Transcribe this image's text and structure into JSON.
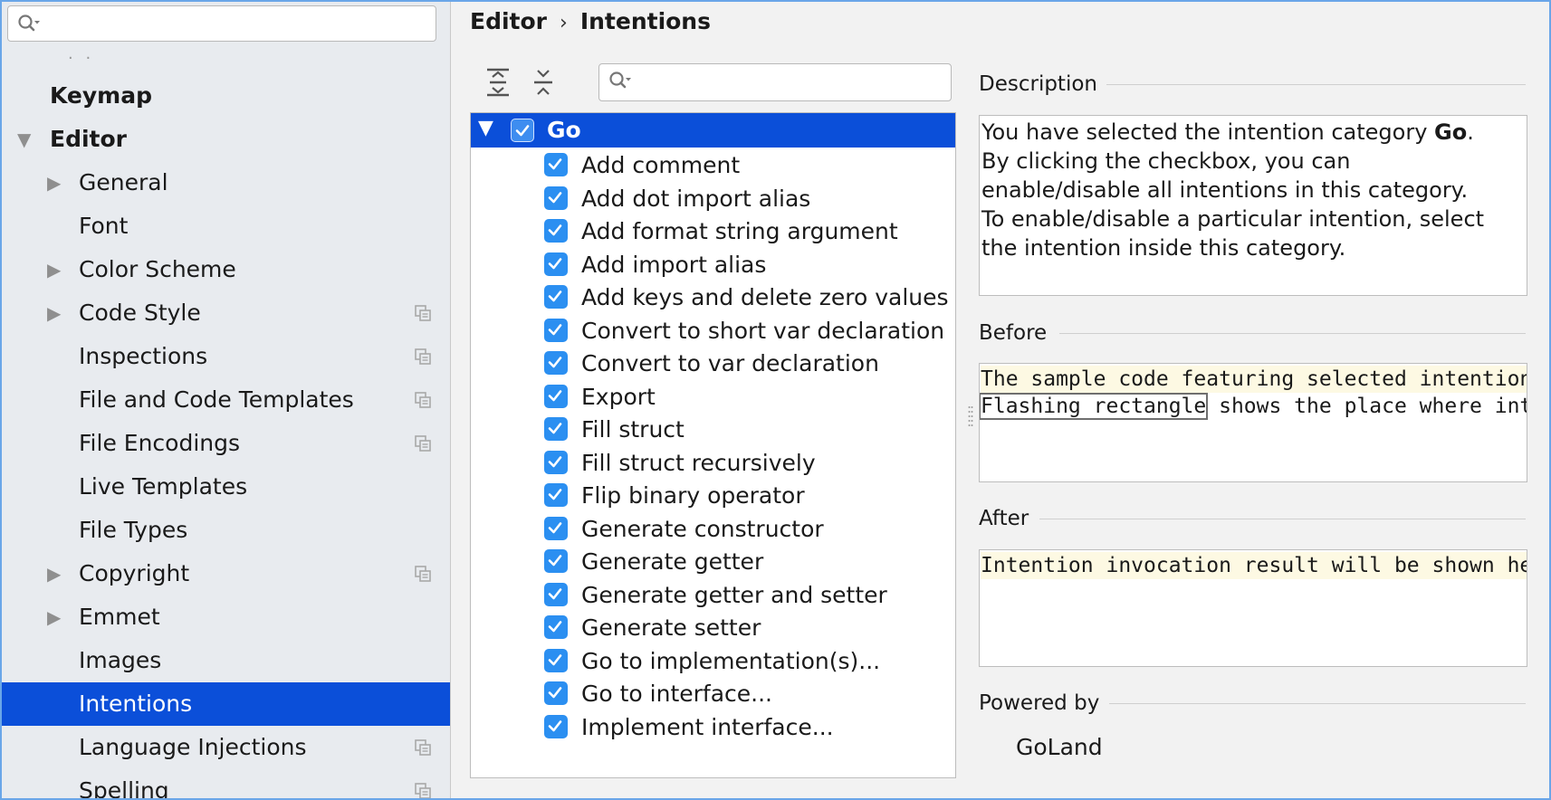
{
  "sidebar": {
    "search_placeholder": "",
    "scroll_hint": "· ·",
    "items": [
      {
        "label": "Keymap",
        "level": 0,
        "bold": true,
        "expander": "none",
        "project": false,
        "selected": false
      },
      {
        "label": "Editor",
        "level": 0,
        "bold": true,
        "expander": "expanded",
        "project": false,
        "selected": false
      },
      {
        "label": "General",
        "level": 1,
        "bold": false,
        "expander": "collapsed",
        "project": false,
        "selected": false
      },
      {
        "label": "Font",
        "level": 1,
        "bold": false,
        "expander": "none",
        "project": false,
        "selected": false
      },
      {
        "label": "Color Scheme",
        "level": 1,
        "bold": false,
        "expander": "collapsed",
        "project": false,
        "selected": false
      },
      {
        "label": "Code Style",
        "level": 1,
        "bold": false,
        "expander": "collapsed",
        "project": true,
        "selected": false
      },
      {
        "label": "Inspections",
        "level": 1,
        "bold": false,
        "expander": "none",
        "project": true,
        "selected": false
      },
      {
        "label": "File and Code Templates",
        "level": 1,
        "bold": false,
        "expander": "none",
        "project": true,
        "selected": false
      },
      {
        "label": "File Encodings",
        "level": 1,
        "bold": false,
        "expander": "none",
        "project": true,
        "selected": false
      },
      {
        "label": "Live Templates",
        "level": 1,
        "bold": false,
        "expander": "none",
        "project": false,
        "selected": false
      },
      {
        "label": "File Types",
        "level": 1,
        "bold": false,
        "expander": "none",
        "project": false,
        "selected": false
      },
      {
        "label": "Copyright",
        "level": 1,
        "bold": false,
        "expander": "collapsed",
        "project": true,
        "selected": false
      },
      {
        "label": "Emmet",
        "level": 1,
        "bold": false,
        "expander": "collapsed",
        "project": false,
        "selected": false
      },
      {
        "label": "Images",
        "level": 1,
        "bold": false,
        "expander": "none",
        "project": false,
        "selected": false
      },
      {
        "label": "Intentions",
        "level": 1,
        "bold": false,
        "expander": "none",
        "project": false,
        "selected": true
      },
      {
        "label": "Language Injections",
        "level": 1,
        "bold": false,
        "expander": "none",
        "project": true,
        "selected": false
      },
      {
        "label": "Spelling",
        "level": 1,
        "bold": false,
        "expander": "none",
        "project": true,
        "selected": false
      }
    ]
  },
  "breadcrumb": {
    "parent": "Editor",
    "separator": "›",
    "current": "Intentions"
  },
  "toolbar": {
    "expand_all_icon": "expand-all-icon",
    "collapse_all_icon": "collapse-all-icon",
    "search_placeholder": ""
  },
  "tree": {
    "root": {
      "label": "Go",
      "checked": true,
      "expanded": true
    },
    "items": [
      {
        "label": "Add comment",
        "checked": true
      },
      {
        "label": "Add dot import alias",
        "checked": true
      },
      {
        "label": "Add format string argument",
        "checked": true
      },
      {
        "label": "Add import alias",
        "checked": true
      },
      {
        "label": "Add keys and delete zero values",
        "checked": true
      },
      {
        "label": "Convert to short var declaration",
        "checked": true
      },
      {
        "label": "Convert to var declaration",
        "checked": true
      },
      {
        "label": "Export",
        "checked": true
      },
      {
        "label": "Fill struct",
        "checked": true
      },
      {
        "label": "Fill struct recursively",
        "checked": true
      },
      {
        "label": "Flip binary operator",
        "checked": true
      },
      {
        "label": "Generate constructor",
        "checked": true
      },
      {
        "label": "Generate getter",
        "checked": true
      },
      {
        "label": "Generate getter and setter",
        "checked": true
      },
      {
        "label": "Generate setter",
        "checked": true
      },
      {
        "label": "Go to implementation(s)...",
        "checked": true
      },
      {
        "label": "Go to interface...",
        "checked": true
      },
      {
        "label": "Implement interface...",
        "checked": true
      }
    ]
  },
  "description": {
    "title": "Description",
    "line1_prefix": "You have selected the intention category ",
    "line1_bold": "Go",
    "line1_suffix": ".",
    "line2": "By clicking the checkbox, you can",
    "line3": "enable/disable all intentions in this category.",
    "line4": "To enable/disable a particular intention, select",
    "line5": "the intention inside this category."
  },
  "before": {
    "title": "Before",
    "line1": "The sample code featuring selected intention",
    "line2_flash": "Flashing rectangle",
    "line2_rest": " shows the place where intention"
  },
  "after": {
    "title": "After",
    "line1": "Intention invocation result will be shown here"
  },
  "powered_by": {
    "title": "Powered by",
    "value": "GoLand"
  },
  "colors": {
    "selection": "#0b4fd9",
    "checkbox": "#2b8ff1",
    "code_highlight": "#fdf9e3",
    "window_border": "#6aa6e8"
  }
}
